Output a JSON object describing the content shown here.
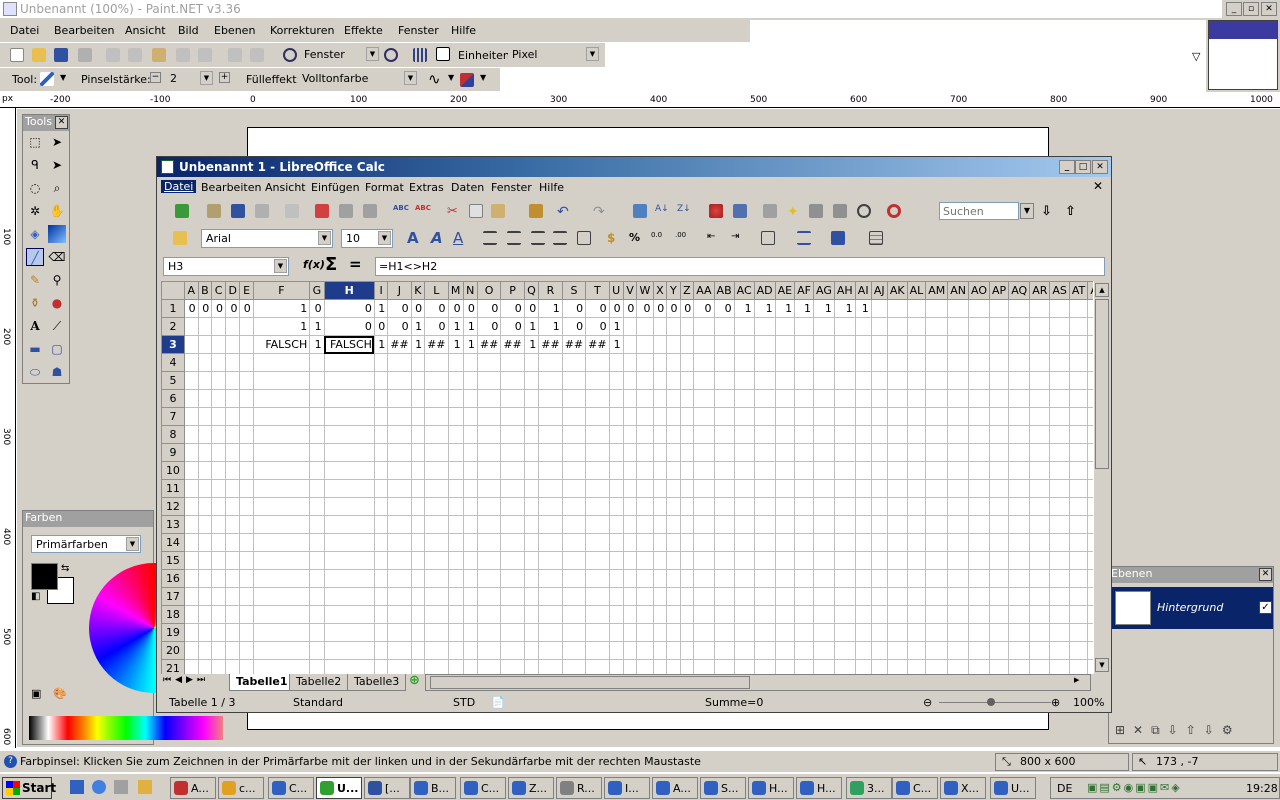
{
  "paintnet": {
    "title": "Unbenannt (100%) - Paint.NET v3.36",
    "menu": [
      "Datei",
      "Bearbeiten",
      "Ansicht",
      "Bild",
      "Ebenen",
      "Korrekturen",
      "Effekte",
      "Fenster",
      "Hilfe"
    ],
    "zoom_label": "Fenster",
    "units_label": "Einheiten:",
    "units_value": "Pixel",
    "tool_label": "Tool:",
    "brush_width_label": "Pinselstärke:",
    "brush_width_value": "2",
    "fill_label": "Fülleffekt:",
    "fill_value": "Volltonfarbe",
    "ruler_unit": "px",
    "ruler_h": [
      "-200",
      "-100",
      "0",
      "100",
      "200",
      "300",
      "400",
      "500",
      "600",
      "700",
      "800",
      "900",
      "1000"
    ],
    "ruler_v": [
      "100",
      "200",
      "300",
      "400",
      "500",
      "600"
    ],
    "tools_title": "Tools",
    "colors_title": "Farben",
    "colors_mode": "Primärfarben",
    "layers_title": "Ebenen",
    "layer_name": "Hintergrund",
    "status_text": "Farbpinsel: Klicken Sie zum Zeichnen in der Primärfarbe mit der linken und in der Sekundärfarbe mit der rechten Maustaste",
    "status_size": "800 x 600",
    "status_coords": "173 , -7"
  },
  "calc": {
    "title": "Unbenannt 1 - LibreOffice Calc",
    "menu": [
      "Datei",
      "Bearbeiten",
      "Ansicht",
      "Einfügen",
      "Format",
      "Extras",
      "Daten",
      "Fenster",
      "Hilfe"
    ],
    "font_name": "Arial",
    "font_size": "10",
    "search_placeholder": "Suchen",
    "name_box": "H3",
    "formula": "=H1<>H2",
    "columns": [
      "A",
      "B",
      "C",
      "D",
      "E",
      "F",
      "G",
      "H",
      "I",
      "J",
      "K",
      "L",
      "M",
      "N",
      "O",
      "P",
      "Q",
      "R",
      "S",
      "T",
      "U",
      "V",
      "W",
      "X",
      "Y",
      "Z",
      "AA",
      "AB",
      "AC",
      "AD",
      "AE",
      "AF",
      "AG",
      "AH",
      "AI",
      "AJ",
      "AK",
      "AL",
      "AM",
      "AN",
      "AO",
      "AP",
      "AQ",
      "AR",
      "AS",
      "AT",
      "AU"
    ],
    "rows": [
      [
        "0",
        "0",
        "0",
        "0",
        "0",
        "1",
        "0",
        "0",
        "1",
        "0",
        "0",
        "0",
        "0",
        "0",
        "0",
        "0",
        "0",
        "1",
        "0",
        "0",
        "0",
        "0",
        "0",
        "0",
        "0",
        "0",
        "0",
        "0",
        "1",
        "1",
        "1",
        "1",
        "1",
        "1",
        "1",
        "",
        "",
        "",
        "",
        "",
        "",
        "",
        "",
        "",
        "",
        "",
        ""
      ],
      [
        "",
        "",
        "",
        "",
        "",
        "1",
        "1",
        "0",
        "0",
        "0",
        "1",
        "0",
        "1",
        "1",
        "0",
        "0",
        "1",
        "1",
        "0",
        "0",
        "1",
        "",
        "",
        "",
        "",
        "",
        "",
        "",
        "",
        "",
        "",
        "",
        "",
        "",
        "",
        "",
        "",
        "",
        "",
        "",
        "",
        "",
        "",
        "",
        "",
        "",
        ""
      ],
      [
        "",
        "",
        "",
        "",
        "",
        "FALSCH",
        "1",
        "FALSCH",
        "1",
        "##",
        "1",
        "##",
        "1",
        "1",
        "##",
        "##",
        "1",
        "##",
        "##",
        "##",
        "1",
        "",
        "",
        "",
        "",
        "",
        "",
        "",
        "",
        "",
        "",
        "",
        "",
        "",
        "",
        "",
        "",
        "",
        "",
        "",
        "",
        "",
        "",
        "",
        "",
        "",
        ""
      ]
    ],
    "row_count": 21,
    "sheet_tabs": [
      "Tabelle1",
      "Tabelle2",
      "Tabelle3"
    ],
    "status_sheet": "Tabelle 1 / 3",
    "status_style": "Standard",
    "status_mode": "STD",
    "status_sum": "Summe=0",
    "status_zoom": "100%"
  },
  "taskbar": {
    "start": "Start",
    "tasks": [
      "A...",
      "c...",
      "C...",
      "U...",
      "[...",
      "B...",
      "C...",
      "Z...",
      "R...",
      "I...",
      "A...",
      "S...",
      "H...",
      "H...",
      "3...",
      "C...",
      "X...",
      "U..."
    ],
    "lang": "DE",
    "clock": "19:28"
  }
}
